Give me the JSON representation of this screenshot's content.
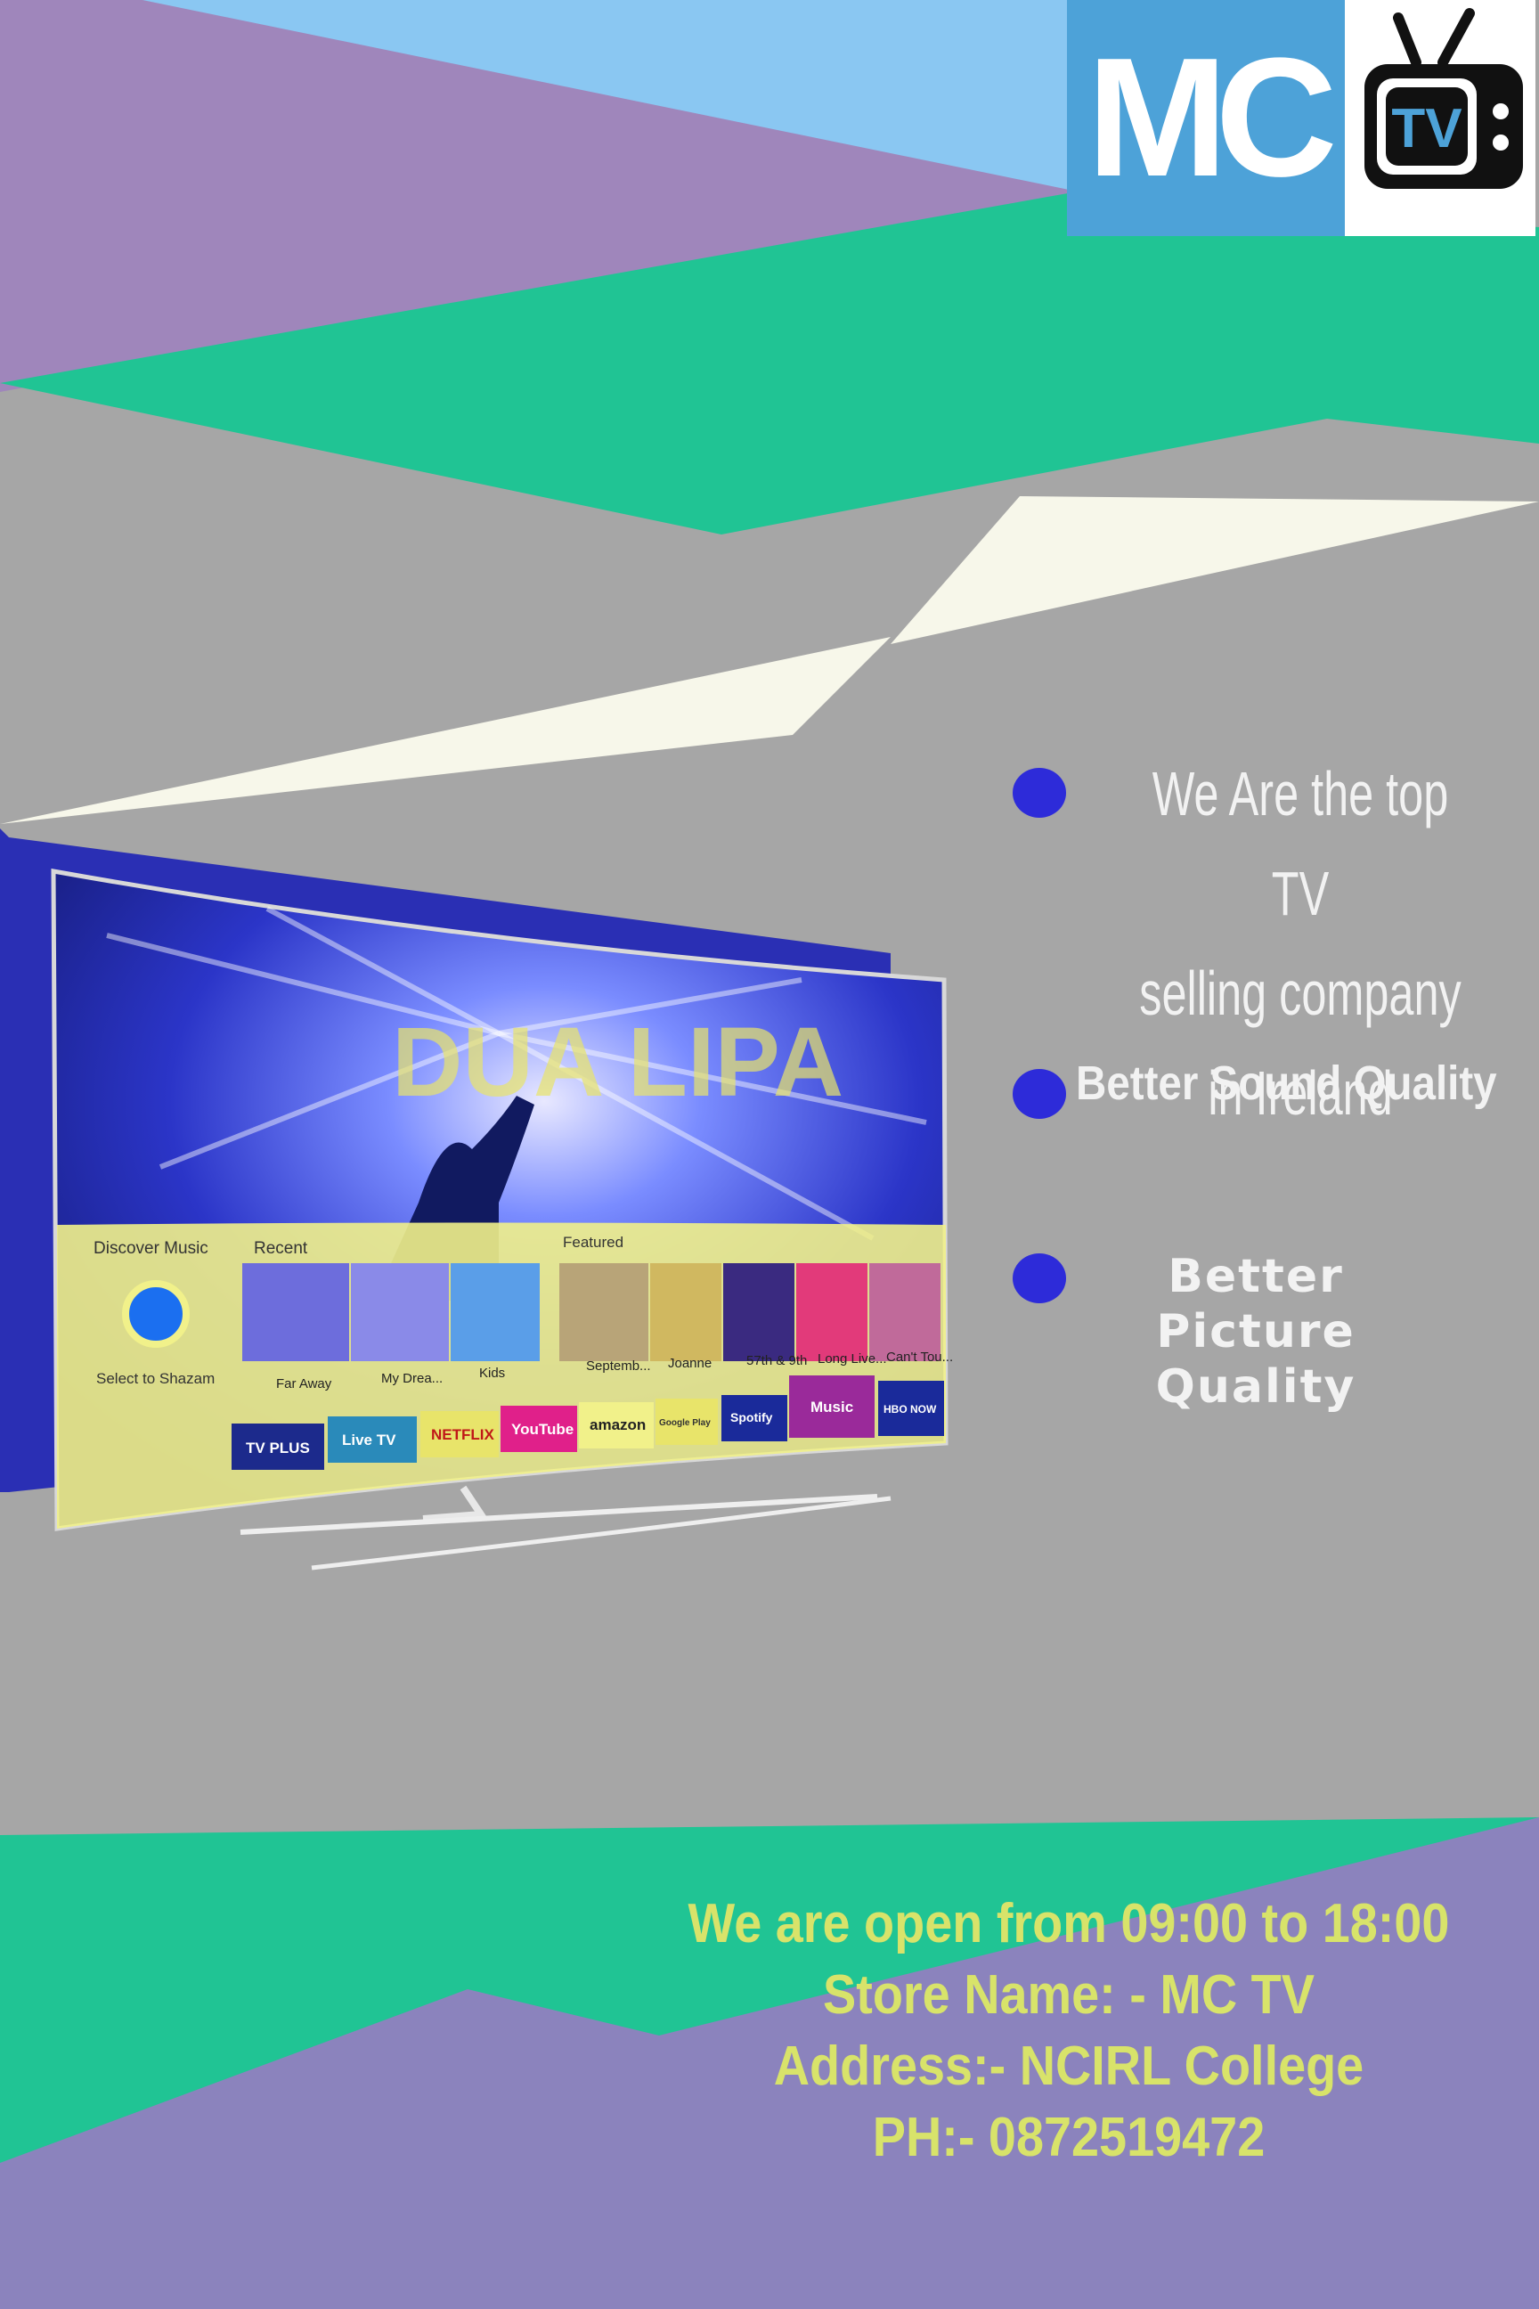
{
  "brand": {
    "logo_text": "MC",
    "logo_badge": "TV",
    "colors": {
      "teal": "#20c494",
      "purple": "#9f86bb",
      "sky": "#8ac7f2",
      "grey": "#a6a6a6",
      "cream": "#f7f7ea",
      "bullet": "#2d2bd9",
      "info_text": "#d8e36a"
    }
  },
  "features": [
    {
      "lines": [
        "We Are the top TV",
        "selling company in Ireland"
      ]
    },
    {
      "lines": [
        "Better Sound Quality"
      ]
    },
    {
      "lines": [
        "Better Picture",
        "Quality"
      ]
    }
  ],
  "tv_screen": {
    "hero_text": "DUA LIPA",
    "discover": "Discover Music",
    "recent": "Recent",
    "featured": "Featured",
    "shazam": "Select to Shazam",
    "tiles": [
      "Far Away",
      "My Drea...",
      "Kids",
      "Septemb...",
      "Joanne",
      "57th & 9th",
      "Long Live...",
      "Can't Tou..."
    ],
    "apps": [
      "TV PLUS",
      "Live TV",
      "NETFLIX",
      "YouTube",
      "amazon",
      "Google Play",
      "Spotify",
      "Music",
      "HBO NOW"
    ]
  },
  "store_info": {
    "hours": "We are open from 09:00 to 18:00",
    "name": "Store Name: - MC TV",
    "address": "Address:-  NCIRL College",
    "phone": "PH:- 0872519472"
  }
}
